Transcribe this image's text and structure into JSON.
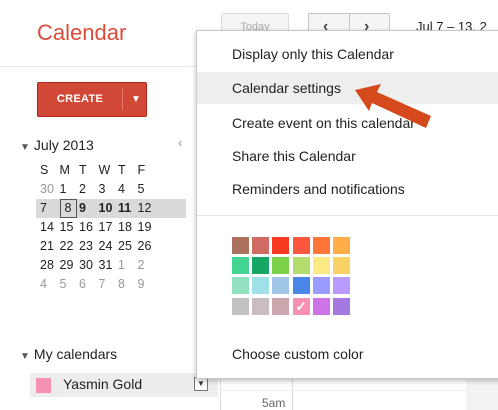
{
  "app": {
    "title": "Calendar"
  },
  "toolbar": {
    "today_label": "Today",
    "prev_icon": "chevron-left-icon",
    "next_icon": "chevron-right-icon",
    "prev_glyph": "‹",
    "next_glyph": "›",
    "date_range": "Jul 7 – 13, 2"
  },
  "create": {
    "label": "CREATE",
    "arrow": "▼"
  },
  "mini_calendar": {
    "month": "July 2013",
    "collapse_glyph": "▼",
    "prev_glyph": "‹",
    "weekdays": [
      "S",
      "M",
      "T",
      "W",
      "T",
      "F"
    ],
    "weeks": [
      [
        "30",
        "1",
        "2",
        "3",
        "4",
        "5"
      ],
      [
        "7",
        "8",
        "9",
        "10",
        "11",
        "12"
      ],
      [
        "14",
        "15",
        "16",
        "17",
        "18",
        "19"
      ],
      [
        "21",
        "22",
        "23",
        "24",
        "25",
        "26"
      ],
      [
        "28",
        "29",
        "30",
        "31",
        "1",
        "2"
      ],
      [
        "4",
        "5",
        "6",
        "7",
        "8",
        "9"
      ]
    ]
  },
  "my_calendars": {
    "heading": "My calendars",
    "collapse_glyph": "▼",
    "items": [
      {
        "name": "Yasmin Gold",
        "color": "#f691b2",
        "dropdown_glyph": "▼"
      }
    ]
  },
  "grid": {
    "time_5am": "5am"
  },
  "menu": {
    "items": [
      "Display only this Calendar",
      "Calendar settings",
      "Create event on this calendar",
      "Share this Calendar",
      "Reminders and notifications"
    ],
    "custom_color": "Choose custom color",
    "checked_glyph": "✓",
    "swatch_colors": [
      [
        "#ac725e",
        "#d06b64",
        "#f83a22",
        "#fa573c",
        "#ff7537",
        "#ffad46"
      ],
      [
        "#42d692",
        "#16a765",
        "#7bd148",
        "#b3dc6c",
        "#fbe983",
        "#fad165"
      ],
      [
        "#92e1c0",
        "#9fe1e7",
        "#9fc6e7",
        "#4986e7",
        "#9a9cff",
        "#b99aff"
      ],
      [
        "#c2c2c2",
        "#cabdbf",
        "#cca6ac",
        "#f691b2",
        "#cd74e6",
        "#a47ae2"
      ]
    ],
    "checked_swatch": "#f691b2"
  },
  "annotation": {
    "arrow_color": "#d44a1c"
  }
}
